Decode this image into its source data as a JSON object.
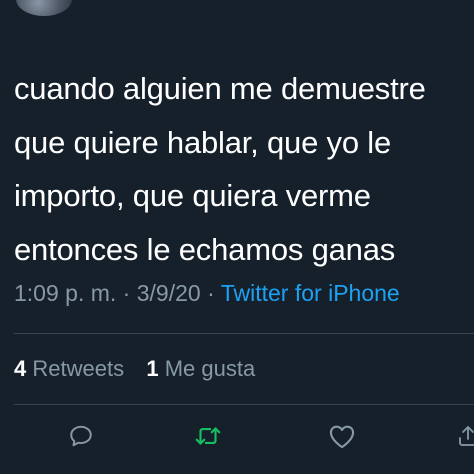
{
  "tweet": {
    "text": "cuando alguien me demuestre\nque quiere hablar, que yo le\nimporto, que quiera verme\nentonces le echamos ganas",
    "time": "1:09 p. m.",
    "separator": "·",
    "date": "3/9/20",
    "source": "Twitter for iPhone"
  },
  "stats": {
    "retweets_count": "4",
    "retweets_label": "Retweets",
    "likes_count": "1",
    "likes_label": "Me gusta"
  },
  "actions": [
    {
      "name": "reply",
      "icon": "speech-bubble-icon"
    },
    {
      "name": "retweet",
      "icon": "retweet-arrows-icon"
    },
    {
      "name": "like",
      "icon": "heart-outline-icon"
    },
    {
      "name": "share",
      "icon": "share-upload-icon"
    }
  ],
  "colors": {
    "background": "#15202b",
    "text": "#ffffff",
    "muted": "#8899a6",
    "link": "#1da1f2",
    "retweet_accent": "#17bf63",
    "divider": "#38444d"
  }
}
